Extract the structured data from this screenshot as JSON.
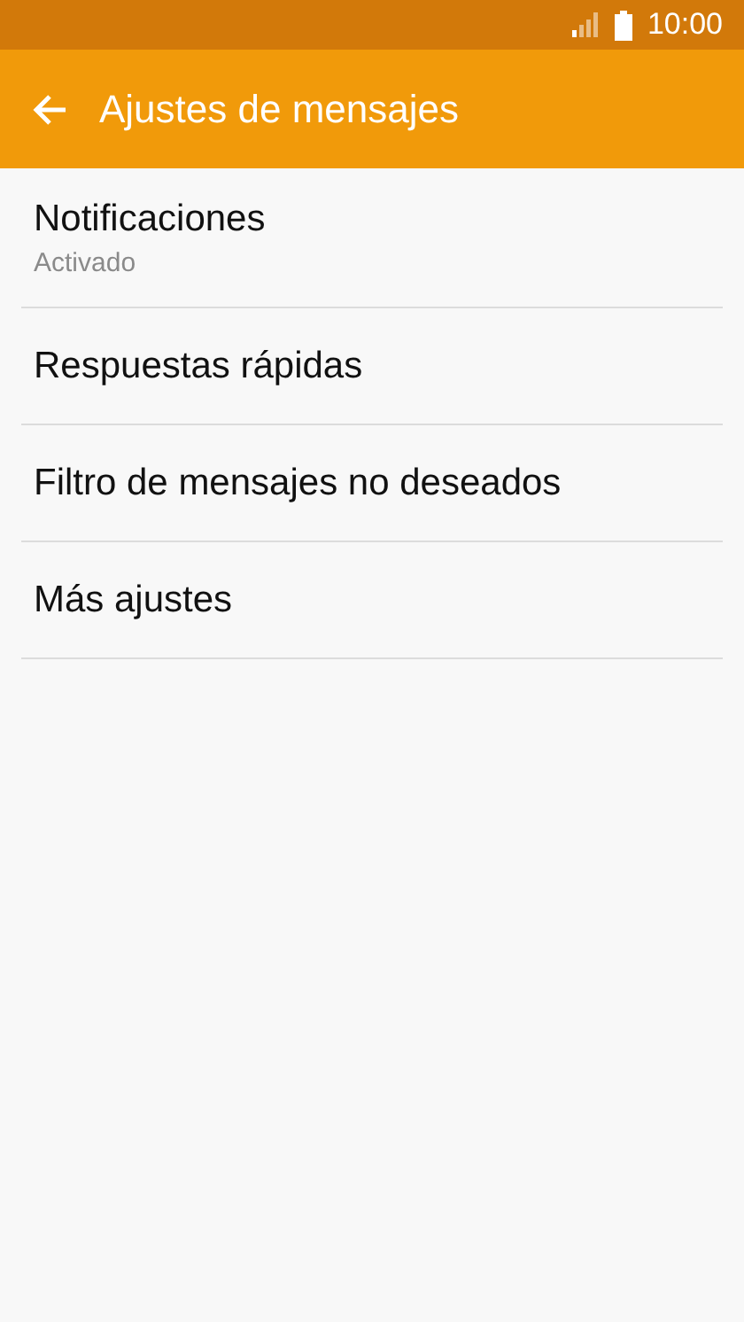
{
  "status_bar": {
    "time": "10:00"
  },
  "app_bar": {
    "title": "Ajustes de mensajes"
  },
  "items": [
    {
      "title": "Notificaciones",
      "subtitle": "Activado"
    },
    {
      "title": "Respuestas rápidas"
    },
    {
      "title": "Filtro de mensajes no deseados"
    },
    {
      "title": "Más ajustes"
    }
  ]
}
